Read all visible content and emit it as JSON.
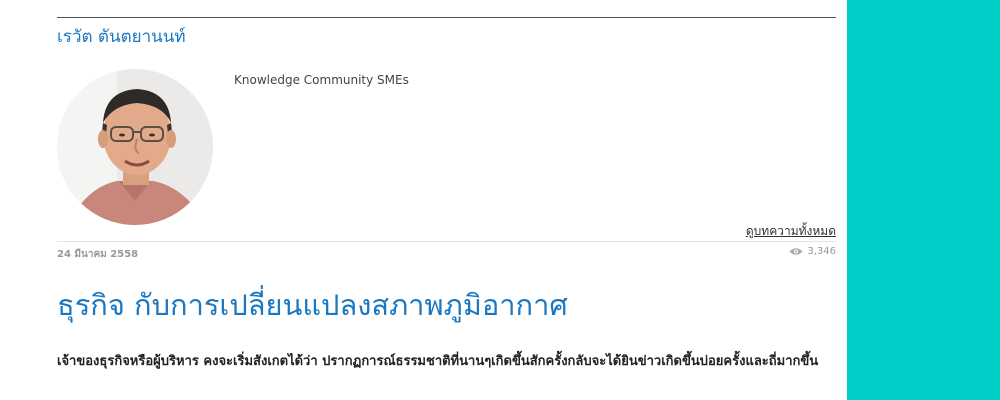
{
  "author": {
    "name": "เรวัต ตันตยานนท์",
    "tagline": "Knowledge Community SMEs",
    "view_all_label": "ดูบทความทั้งหมด"
  },
  "article": {
    "date": "24 มีนาคม 2558",
    "views": "3,346",
    "title": "ธุรกิจ กับการเปลี่ยนแปลงสภาพภูมิอากาศ",
    "lead": "เจ้าของธุรกิจหรือผู้บริหาร คงจะเริ่มสังเกตได้ว่า ปรากฏการณ์ธรรมชาติที่นานๆเกิดขึ้นสักครั้งกลับจะได้ยินข่าวเกิดขึ้นบ่อยครั้งและถี่มากขึ้น"
  },
  "colors": {
    "accent": "#1a78c2",
    "sidebar": "#00cdc5"
  },
  "icons": {
    "views": "eye-icon"
  }
}
